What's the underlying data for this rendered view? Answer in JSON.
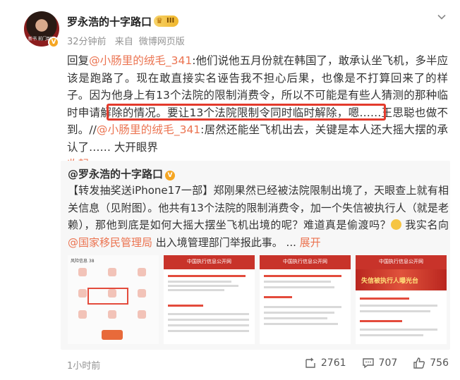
{
  "post": {
    "author": "罗永浩的十字路口",
    "badge_label": "III",
    "avatar_caption": "新书\n前门到前",
    "time": "32分钟前",
    "source_prefix": "来自",
    "source": "微博网页版",
    "content": {
      "reply_prefix": "回复",
      "reply_mention": "@小肠里的绒毛_341",
      "text_1": ":他们说他五月份就在韩国了，敢承认坐飞机，多半应该是跑路了。现在敢直接实名诬告我不担心后果，也像是不打算回来了的样子。因为他身上有13个法院的限制消费令，所以不可能是有些人猜测的那种临时申请解除的情况。要让13个法院限制令同时临时解除，嗯……王思聪也做不到。//",
      "mention_2": "@小肠里的绒毛_341",
      "text_2": ":居然还能坐飞机出去，关键是本人还大摇大摆的承认了…… 大开眼界",
      "collapse": "收起"
    },
    "retweet": {
      "author": "@罗永浩的十字路口",
      "text_1": "【转发抽奖送iPhone17一部】郑刚果然已经被法院限制出境了，天眼查上就有相关信息（见附图）。他共有13个法院的限制消费令，加一个失信被执行人（就是老赖），那他到底是如何大摇大摆坐飞机出境的呢？难道真是偷渡吗？",
      "text_2": " 我实名向 ",
      "mention": "@国家移民管理局",
      "text_3": " 出入境管理部门举报此事。 ... ",
      "expand": "展开",
      "thumbs": [
        {
          "title": "风险信息 38"
        },
        {
          "title": "中国执行信息公开网"
        },
        {
          "title": "中国执行信息公开网"
        },
        {
          "title": "中国执行信息公开网",
          "banner": "失信被执行人曝光台"
        }
      ]
    },
    "footer": {
      "time": "1小时前",
      "repost_count": "2761",
      "comment_count": "707",
      "like_count": "756"
    }
  },
  "colors": {
    "accent_link": "#eb7350",
    "highlight_border": "#e33a2c",
    "badge": "#f5a623"
  }
}
